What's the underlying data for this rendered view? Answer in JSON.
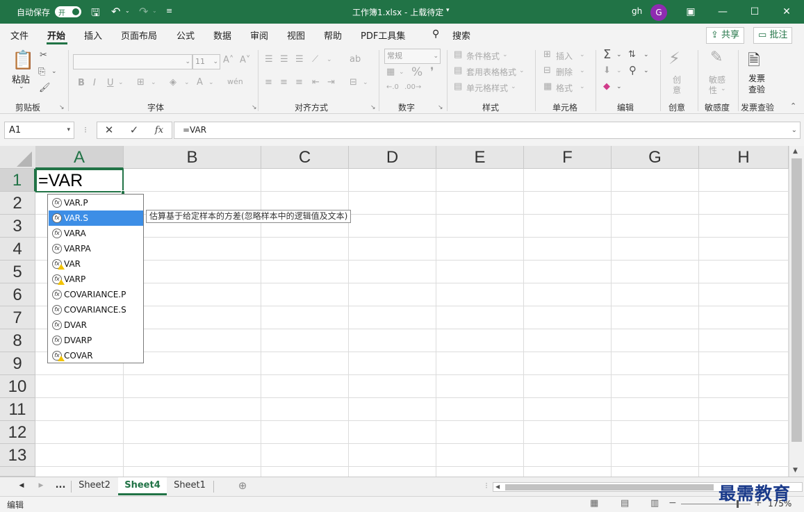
{
  "titlebar": {
    "autosave_label": "自动保存",
    "autosave_state": "开",
    "doc_title": "工作簿1.xlsx - 上载待定",
    "user_name": "gh",
    "avatar_letter": "G",
    "accent": "#217346"
  },
  "menu": {
    "tabs": [
      "文件",
      "开始",
      "插入",
      "页面布局",
      "公式",
      "数据",
      "审阅",
      "视图",
      "帮助",
      "PDF工具集"
    ],
    "search_label": "搜索",
    "share_label": "共享",
    "comments_label": "批注"
  },
  "ribbon": {
    "groups": {
      "clipboard": "剪贴板",
      "font": "字体",
      "alignment": "对齐方式",
      "number": "数字",
      "styles": "样式",
      "cells": "单元格",
      "editing": "编辑",
      "creative": "创意",
      "sensitivity": "敏感度",
      "invoice": "发票查验"
    },
    "paste_label": "粘贴",
    "font_size": "11",
    "number_format": "常规",
    "cond_format": "条件格式",
    "table_format": "套用表格格式",
    "cell_style": "单元格样式",
    "insert": "插入",
    "delete": "删除",
    "format": "格式",
    "creative_btn_1": "创",
    "creative_btn_2": "意",
    "sensitivity_btn_1": "敏感",
    "sensitivity_btn_2": "性",
    "invoice_btn_1": "发票",
    "invoice_btn_2": "查验"
  },
  "formula_bar": {
    "name_box": "A1",
    "formula": "=VAR"
  },
  "grid": {
    "columns": [
      "A",
      "B",
      "C",
      "D",
      "E",
      "F",
      "G",
      "H"
    ],
    "rows": [
      "1",
      "2",
      "3",
      "4",
      "5",
      "6",
      "7",
      "8",
      "9",
      "10",
      "11",
      "12",
      "13"
    ],
    "active_cell_value": "=VAR"
  },
  "autocomplete": {
    "items": [
      {
        "name": "VAR.P",
        "compat": false
      },
      {
        "name": "VAR.S",
        "compat": false,
        "selected": true
      },
      {
        "name": "VARA",
        "compat": false
      },
      {
        "name": "VARPA",
        "compat": false
      },
      {
        "name": "VAR",
        "compat": true
      },
      {
        "name": "VARP",
        "compat": true
      },
      {
        "name": "COVARIANCE.P",
        "compat": false
      },
      {
        "name": "COVARIANCE.S",
        "compat": false
      },
      {
        "name": "DVAR",
        "compat": false
      },
      {
        "name": "DVARP",
        "compat": false
      },
      {
        "name": "COVAR",
        "compat": true
      }
    ],
    "tooltip": "估算基于给定样本的方差(忽略样本中的逻辑值及文本)"
  },
  "sheets": {
    "more": "...",
    "tabs": [
      "Sheet2",
      "Sheet4",
      "Sheet1"
    ],
    "active": "Sheet4"
  },
  "statusbar": {
    "mode": "编辑",
    "zoom": "175%"
  },
  "watermark": "最需教育"
}
